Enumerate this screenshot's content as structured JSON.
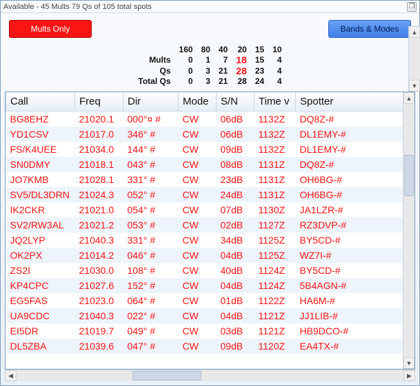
{
  "window": {
    "title": "Available - 45 Mults 79 Qs of 105 total spots"
  },
  "toolbar": {
    "mults_only": "Mults Only",
    "bands_modes": "Bands & Modes"
  },
  "summary": {
    "bands": [
      "160",
      "80",
      "40",
      "20",
      "15",
      "10"
    ],
    "rows": [
      {
        "label": "Mults",
        "values": [
          "0",
          "1",
          "7",
          "18",
          "15",
          "4"
        ],
        "hot_index": 3
      },
      {
        "label": "Qs",
        "values": [
          "0",
          "3",
          "21",
          "28",
          "23",
          "4"
        ],
        "hot_index": 3
      },
      {
        "label": "Total Qs",
        "values": [
          "0",
          "3",
          "21",
          "28",
          "24",
          "4"
        ],
        "hot_index": null
      }
    ]
  },
  "columns": {
    "call": "Call",
    "freq": "Freq",
    "dir": "Dir",
    "mode": "Mode",
    "sn": "S/N",
    "time": "Time v",
    "spotter": "Spotter"
  },
  "rows": [
    {
      "call": "BG8EHZ",
      "freq": "21020.1",
      "dir": "000°¤ #",
      "mode": "CW",
      "sn": "06dB",
      "time": "1132Z",
      "spotter": "DQ8Z-#"
    },
    {
      "call": "YD1CSV",
      "freq": "21017.0",
      "dir": "346° #",
      "mode": "CW",
      "sn": "06dB",
      "time": "1132Z",
      "spotter": "DL1EMY-#"
    },
    {
      "call": "FS/K4UEE",
      "freq": "21034.0",
      "dir": "144° #",
      "mode": "CW",
      "sn": "09dB",
      "time": "1132Z",
      "spotter": "DL1EMY-#"
    },
    {
      "call": "SN0DMY",
      "freq": "21018.1",
      "dir": "043° #",
      "mode": "CW",
      "sn": "08dB",
      "time": "1131Z",
      "spotter": "DQ8Z-#"
    },
    {
      "call": "JO7KMB",
      "freq": "21028.1",
      "dir": "331° #",
      "mode": "CW",
      "sn": "23dB",
      "time": "1131Z",
      "spotter": "OH6BG-#"
    },
    {
      "call": "SV5/DL3DRN",
      "freq": "21024.3",
      "dir": "052° #",
      "mode": "CW",
      "sn": "24dB",
      "time": "1131Z",
      "spotter": "OH6BG-#"
    },
    {
      "call": "IK2CKR",
      "freq": "21021.0",
      "dir": "054° #",
      "mode": "CW",
      "sn": "07dB",
      "time": "1130Z",
      "spotter": "JA1LZR-#"
    },
    {
      "call": "SV2/RW3AL",
      "freq": "21021.2",
      "dir": "053° #",
      "mode": "CW",
      "sn": "02dB",
      "time": "1127Z",
      "spotter": "RZ3DVP-#"
    },
    {
      "call": "JQ2LYP",
      "freq": "21040.3",
      "dir": "331° #",
      "mode": "CW",
      "sn": "34dB",
      "time": "1125Z",
      "spotter": "BY5CD-#"
    },
    {
      "call": "OK2PX",
      "freq": "21014.2",
      "dir": "046° #",
      "mode": "CW",
      "sn": "04dB",
      "time": "1125Z",
      "spotter": "WZ7I-#"
    },
    {
      "call": "ZS2I",
      "freq": "21030.0",
      "dir": "108° #",
      "mode": "CW",
      "sn": "40dB",
      "time": "1124Z",
      "spotter": "BY5CD-#"
    },
    {
      "call": "KP4CPC",
      "freq": "21027.6",
      "dir": "152° #",
      "mode": "CW",
      "sn": "04dB",
      "time": "1124Z",
      "spotter": "5B4AGN-#"
    },
    {
      "call": "EG5FAS",
      "freq": "21023.0",
      "dir": "064° #",
      "mode": "CW",
      "sn": "01dB",
      "time": "1122Z",
      "spotter": "HA6M-#"
    },
    {
      "call": "UA9CDC",
      "freq": "21040.3",
      "dir": "022° #",
      "mode": "CW",
      "sn": "04dB",
      "time": "1121Z",
      "spotter": "JJ1LIB-#"
    },
    {
      "call": "EI5DR",
      "freq": "21019.7",
      "dir": "049° #",
      "mode": "CW",
      "sn": "03dB",
      "time": "1121Z",
      "spotter": "HB9DCO-#"
    },
    {
      "call": "DL5ZBA",
      "freq": "21039.6",
      "dir": "047° #",
      "mode": "CW",
      "sn": "09dB",
      "time": "1120Z",
      "spotter": "EA4TX-#"
    }
  ]
}
